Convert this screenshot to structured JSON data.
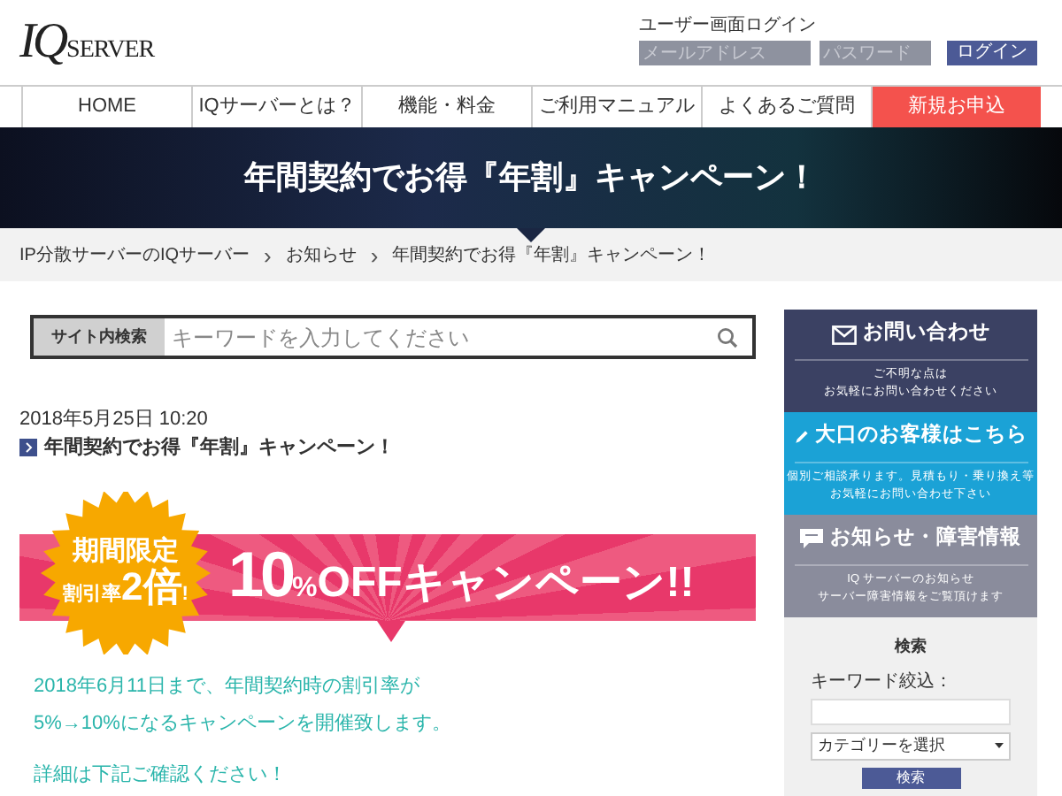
{
  "header": {
    "logo": {
      "mark": "IQ",
      "word": "SERVER"
    },
    "login": {
      "title": "ユーザー画面ログイン",
      "email_placeholder": "メールアドレス",
      "password_placeholder": "パスワード",
      "button": "ログイン"
    }
  },
  "nav": [
    {
      "label": "HOME",
      "kind": "normal"
    },
    {
      "label": "IQサーバーとは？",
      "kind": "normal"
    },
    {
      "label": "機能・料金",
      "kind": "normal"
    },
    {
      "label": "ご利用マニュアル",
      "kind": "normal"
    },
    {
      "label": "よくあるご質問",
      "kind": "normal"
    },
    {
      "label": "新規お申込",
      "kind": "cta"
    }
  ],
  "hero": {
    "title": "年間契約でお得『年割』キャンペーン！"
  },
  "breadcrumb": [
    {
      "kind": "link",
      "label": "IP分散サーバーのIQサーバー"
    },
    {
      "kind": "separator",
      "label": "›"
    },
    {
      "kind": "link",
      "label": "お知らせ"
    },
    {
      "kind": "separator",
      "label": "›"
    },
    {
      "kind": "current",
      "label": "年間契約でお得『年割』キャンペーン！"
    }
  ],
  "site_search": {
    "label": "サイト内検索",
    "placeholder": "キーワードを入力してください"
  },
  "post": {
    "date": "2018年5月25日 10:20",
    "title": "年間契約でお得『年割』キャンペーン！",
    "banner": {
      "badge_line1": "期間限定",
      "badge_prefix": "割引率",
      "badge_big": "2倍",
      "badge_suffix": "!",
      "big": "10",
      "percent": "%",
      "headline": "OFFキャンペーン!!"
    },
    "paragraphs": [
      [
        "2018年6月11日まで、年間契約時の割引率が",
        "5%→10%になるキャンペーンを開催致します。"
      ],
      [
        "詳細は下記ご確認ください！"
      ]
    ]
  },
  "sidebar": {
    "panels": [
      {
        "kind": "mail",
        "title": "お問い合わせ",
        "lines": [
          "ご不明な点は",
          "お気軽にお問い合わせください"
        ]
      },
      {
        "kind": "pencil",
        "title": "大口のお客様はこちら",
        "lines": [
          "個別ご相談承ります。見積もり・乗り換え等",
          "お気軽にお問い合わせ下さい"
        ]
      },
      {
        "kind": "chat",
        "title": "お知らせ・障害情報",
        "lines": [
          "IQ サーバーのお知らせ",
          "サーバー障害情報をご覧頂けます"
        ]
      }
    ],
    "search": {
      "title": "検索",
      "keyword_label": "キーワード絞込：",
      "category": "カテゴリーを選択",
      "button": "検索"
    }
  }
}
